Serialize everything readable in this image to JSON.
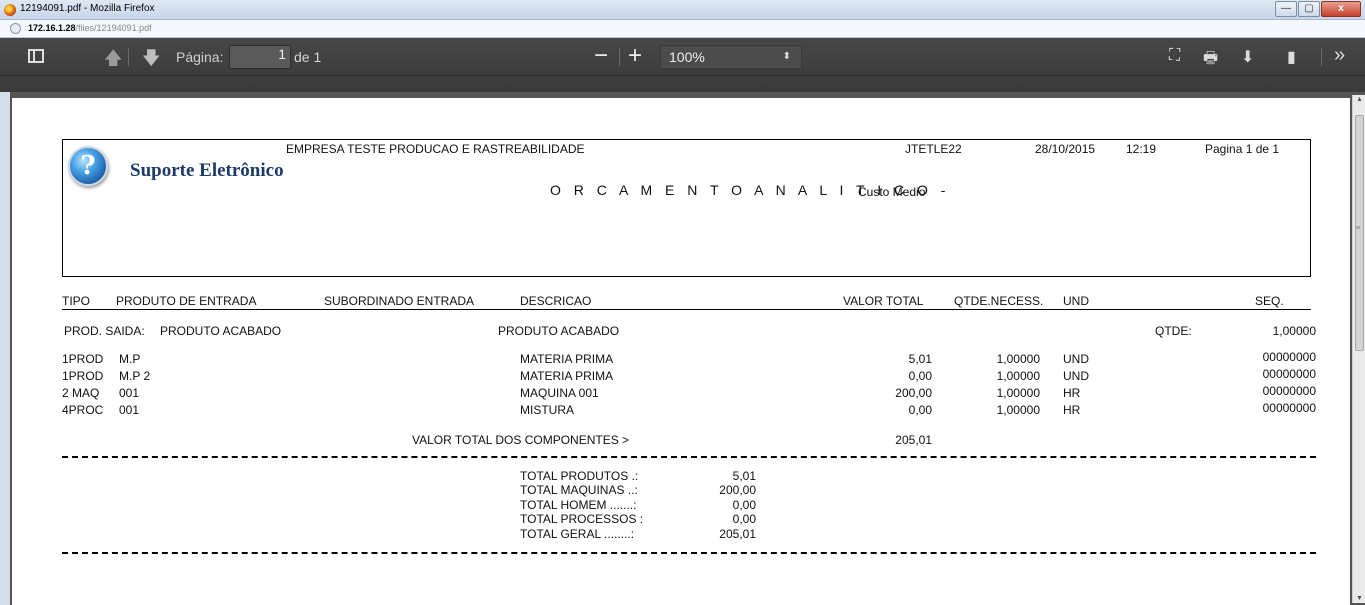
{
  "window": {
    "title": "12194091.pdf - Mozilla Firefox",
    "url_host": "172.16.1.28",
    "url_path": "/files/12194091.pdf",
    "buttons": {
      "minimize": "—",
      "maximize": "▢",
      "close": "x"
    }
  },
  "toolbar": {
    "page_label": "Página:",
    "page_value": "1",
    "page_of": "de 1",
    "zoom_out": "−",
    "zoom_in": "+",
    "zoom_value": "100%",
    "icons": [
      "sidebar-icon",
      "arrow-up-icon",
      "arrow-down-icon",
      "zoom-out-icon",
      "zoom-in-icon",
      "fullscreen-icon",
      "print-icon",
      "download-icon",
      "bookmark-icon",
      "more-icon"
    ]
  },
  "report": {
    "company": "EMPRESA TESTE PRODUCAO E RASTREABILIDADE",
    "user": "JTETLE22",
    "date": "28/10/2015",
    "time": "12:19",
    "page": "Pagina 1 de   1",
    "brand": "Suporte Eletrônico",
    "title": "O R C A M E N T O   A N A L I T I C O  -",
    "cost_method": "Custo Medio",
    "columns": {
      "tipo": "TIPO",
      "produto_entrada": "PRODUTO DE ENTRADA",
      "subordinado": "SUBORDINADO ENTRADA",
      "descricao": "DESCRICAO",
      "valor_total": "VALOR TOTAL",
      "qtde": "QTDE.NECESS.",
      "und": "UND",
      "seq": "SEQ."
    },
    "prod_saida": {
      "label": "PROD. SAIDA:",
      "code": "PRODUTO ACABADO",
      "description": "PRODUTO ACABADO",
      "qtde_label": "QTDE:",
      "qtde": "1,00000"
    },
    "rows": [
      {
        "tipo": "1PROD",
        "produto": "M.P",
        "descricao": "MATERIA PRIMA",
        "valor": "5,01",
        "qtde": "1,00000",
        "und": "UND",
        "seq": "00000000"
      },
      {
        "tipo": "1PROD",
        "produto": "M.P 2",
        "descricao": "MATERIA PRIMA",
        "valor": "0,00",
        "qtde": "1,00000",
        "und": "UND",
        "seq": "00000000"
      },
      {
        "tipo": "2 MAQ",
        "produto": "001",
        "descricao": "MAQUINA 001",
        "valor": "200,00",
        "qtde": "1,00000",
        "und": "HR",
        "seq": "00000000"
      },
      {
        "tipo": "4PROC",
        "produto": "001",
        "descricao": "MISTURA",
        "valor": "0,00",
        "qtde": "1,00000",
        "und": "HR",
        "seq": "00000000"
      }
    ],
    "components_total_label": "VALOR TOTAL DOS COMPONENTES >",
    "components_total": "205,01",
    "totals": [
      {
        "label": "TOTAL PRODUTOS .:",
        "value": "5,01"
      },
      {
        "label": "TOTAL MAQUINAS ..:",
        "value": "200,00"
      },
      {
        "label": "TOTAL HOMEM .......:",
        "value": "0,00"
      },
      {
        "label": "TOTAL PROCESSOS :",
        "value": "0,00"
      },
      {
        "label": "TOTAL GERAL ........:",
        "value": "205,01"
      }
    ]
  }
}
